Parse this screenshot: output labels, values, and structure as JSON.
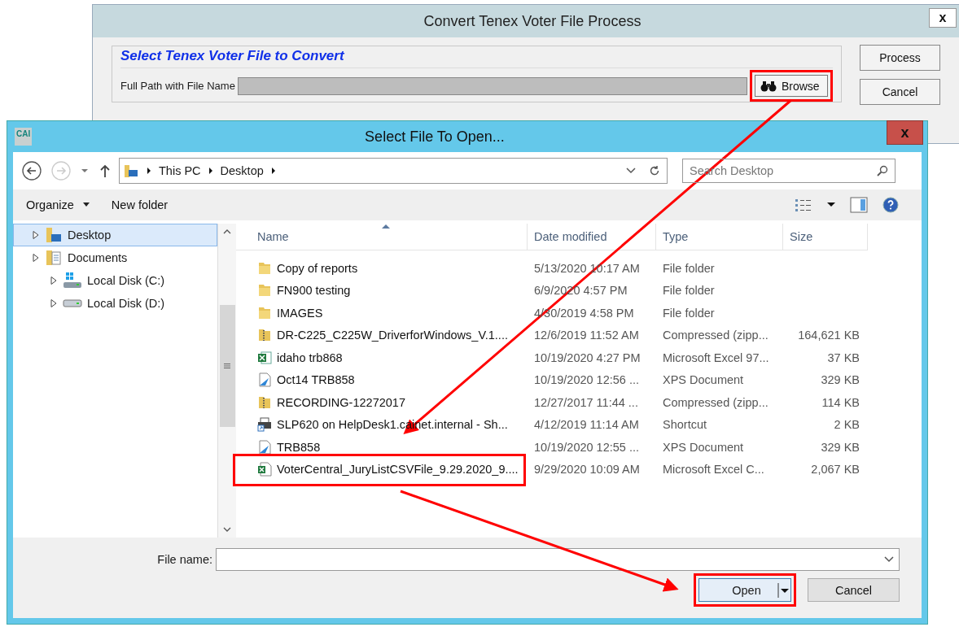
{
  "back_window": {
    "title": "Convert Tenex Voter File Process",
    "close": "x",
    "section_title": "Select Tenex Voter File to Convert",
    "path_label": "Full Path with File Name",
    "browse": {
      "label": "Browse",
      "highlighted": true
    },
    "buttons": [
      "Process",
      "Cancel"
    ]
  },
  "dialog": {
    "title": "Select File To Open...",
    "app_badge": "CAI",
    "close": "x",
    "breadcrumb": [
      "This PC",
      "Desktop"
    ],
    "search": {
      "placeholder": "Search Desktop"
    },
    "toolbar": [
      "Organize",
      "New folder"
    ],
    "tree": [
      {
        "label": "Desktop",
        "kind": "desktop",
        "selected": true
      },
      {
        "label": "Documents",
        "kind": "documents",
        "selected": false
      },
      {
        "label": "Local Disk (C:)",
        "kind": "system-drive",
        "selected": false
      },
      {
        "label": "Local Disk (D:)",
        "kind": "drive",
        "selected": false
      }
    ],
    "columns": [
      {
        "label": "Name",
        "sorted": true
      },
      {
        "label": "Date modified",
        "sorted": false
      },
      {
        "label": "Type",
        "sorted": false
      },
      {
        "label": "Size",
        "sorted": false
      }
    ],
    "rows": [
      {
        "name": "Copy of reports",
        "date": "5/13/2020 10:17 AM",
        "type": "File folder",
        "kind": "folder",
        "highlighted": false
      },
      {
        "name": "FN900 testing",
        "date": "6/9/2020 4:57 PM",
        "type": "File folder",
        "kind": "folder",
        "highlighted": false
      },
      {
        "name": "IMAGES",
        "date": "4/30/2019 4:58 PM",
        "type": "File folder",
        "kind": "folder",
        "highlighted": false
      },
      {
        "name": "DR-C225_C225W_DriverforWindows_V.1....",
        "date": "12/6/2019 11:52 AM",
        "type": "Compressed (zipp...",
        "size": "164,621 KB",
        "kind": "zip",
        "highlighted": false
      },
      {
        "name": "idaho trb868",
        "date": "10/19/2020 4:27 PM",
        "type": "Microsoft Excel 97...",
        "size": "37 KB",
        "kind": "excel",
        "highlighted": false
      },
      {
        "name": "Oct14 TRB858",
        "date": "10/19/2020 12:56 ...",
        "type": "XPS Document",
        "size": "329 KB",
        "kind": "xps",
        "highlighted": false
      },
      {
        "name": "RECORDING-12272017",
        "date": "12/27/2017 11:44 ...",
        "type": "Compressed (zipp...",
        "size": "114 KB",
        "kind": "zip",
        "highlighted": false
      },
      {
        "name": "SLP620 on HelpDesk1.cainet.internal - Sh...",
        "date": "4/12/2019 11:14 AM",
        "type": "Shortcut",
        "size": "2 KB",
        "kind": "shortcut",
        "highlighted": false
      },
      {
        "name": "TRB858",
        "date": "10/19/2020 12:55 ...",
        "type": "XPS Document",
        "size": "329 KB",
        "kind": "xps",
        "highlighted": false
      },
      {
        "name": "VoterCentral_JuryListCSVFile_9.29.2020_9....",
        "date": "9/29/2020 10:09 AM",
        "type": "Microsoft Excel C...",
        "size": "2,067 KB",
        "kind": "csv",
        "highlighted": true
      }
    ],
    "file_name_label": "File name:",
    "open": {
      "label": "Open",
      "highlighted": true
    },
    "cancel": "Cancel"
  }
}
